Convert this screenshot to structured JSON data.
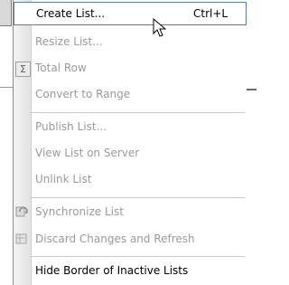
{
  "menu": {
    "items": [
      {
        "label": "Create List...",
        "shortcut": "Ctrl+L",
        "enabled": true,
        "hover": true
      },
      {
        "label": "Resize List...",
        "enabled": false
      },
      {
        "label": "Total Row",
        "enabled": false,
        "icon": "sigma-icon"
      },
      {
        "label": "Convert to Range",
        "enabled": false
      },
      {
        "label": "Publish List...",
        "enabled": false
      },
      {
        "label": "View List on Server",
        "enabled": false
      },
      {
        "label": "Unlink List",
        "enabled": false
      },
      {
        "label": "Synchronize List",
        "enabled": false,
        "icon": "synchronize-icon"
      },
      {
        "label": "Discard Changes and Refresh",
        "enabled": false,
        "icon": "discard-icon"
      },
      {
        "label": "Hide Border of Inactive Lists",
        "enabled": true
      }
    ]
  },
  "icons": {
    "sigma": "Σ",
    "cursor": "mouse-pointer-icon"
  },
  "colors": {
    "enabled_text": "#000000",
    "disabled_text": "#9a9a9a",
    "hover_border": "#5a7fa5"
  }
}
